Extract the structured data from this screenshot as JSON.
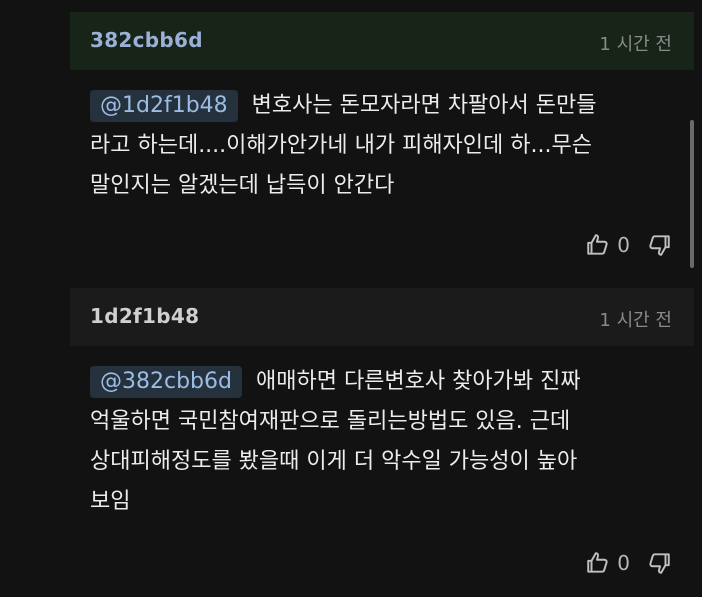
{
  "comments": [
    {
      "author": "382cbb6d",
      "time": "1 시간 전",
      "mention": "@1d2f1b48",
      "lines": [
        "변호사는 돈모자라면 차팔아서 돈만들",
        "라고 하는데....이해가안가네 내가 피해자인데 하...무슨",
        "말인지는 알겠는데 납득이 안간다"
      ],
      "likes": "0"
    },
    {
      "author": "1d2f1b48",
      "time": "1 시간 전",
      "mention": "@382cbb6d",
      "lines": [
        "애매하면 다른변호사 찾아가봐 진짜",
        "억울하면 국민참여재판으로 돌리는방법도 있음. 근데",
        "상대피해정도를 봤을때 이게 더 악수일 가능성이 높아",
        "보임"
      ],
      "likes": "0"
    }
  ],
  "icons": {
    "like": "thumb-up-icon",
    "dislike": "thumb-down-icon"
  },
  "colors": {
    "background": "#121212",
    "highlight_header": "#172417",
    "mention_bg": "#25313d",
    "mention_text": "#9bbde3"
  }
}
